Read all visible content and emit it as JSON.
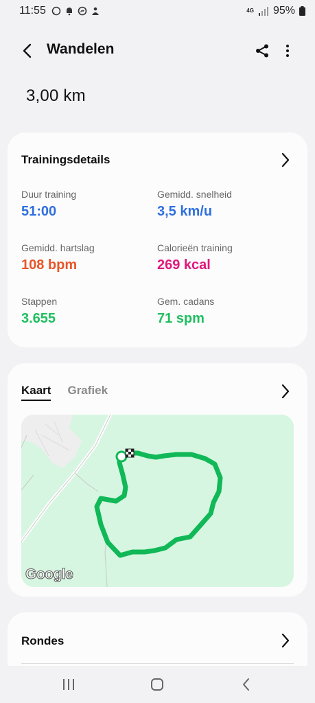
{
  "status_bar": {
    "time": "11:55",
    "network": "4G",
    "battery": "95%",
    "icons": [
      "whatsapp-icon",
      "notification-bell-icon",
      "messenger-icon",
      "app-icon"
    ]
  },
  "header": {
    "title": "Wandelen",
    "back_icon": "chevron-left-icon",
    "share_icon": "share-icon",
    "more_icon": "more-vertical-icon"
  },
  "summary": {
    "distance": "3,00 km"
  },
  "training_details": {
    "title": "Trainingsdetails",
    "stats": [
      {
        "label": "Duur training",
        "value": "51:00",
        "color": "#2f6fde"
      },
      {
        "label": "Gemidd. snelheid",
        "value": "3,5 km/u",
        "color": "#2f6fde"
      },
      {
        "label": "Gemidd. hartslag",
        "value": "108 bpm",
        "color": "#e8562a"
      },
      {
        "label": "Calorieën training",
        "value": "269 kcal",
        "color": "#e2177e"
      },
      {
        "label": "Stappen",
        "value": "3.655",
        "color": "#1fbf5f"
      },
      {
        "label": "Gem. cadans",
        "value": "71 spm",
        "color": "#1fbf5f"
      }
    ]
  },
  "map_card": {
    "tabs": [
      {
        "label": "Kaart",
        "active": true
      },
      {
        "label": "Grafiek",
        "active": false
      }
    ],
    "map_label": "Google",
    "route_color": "#10b857",
    "map_color": "#d6f6e1"
  },
  "laps": {
    "title": "Rondes"
  },
  "nav_bar": {
    "icons": [
      "recent-apps-icon",
      "home-icon",
      "back-icon"
    ]
  }
}
